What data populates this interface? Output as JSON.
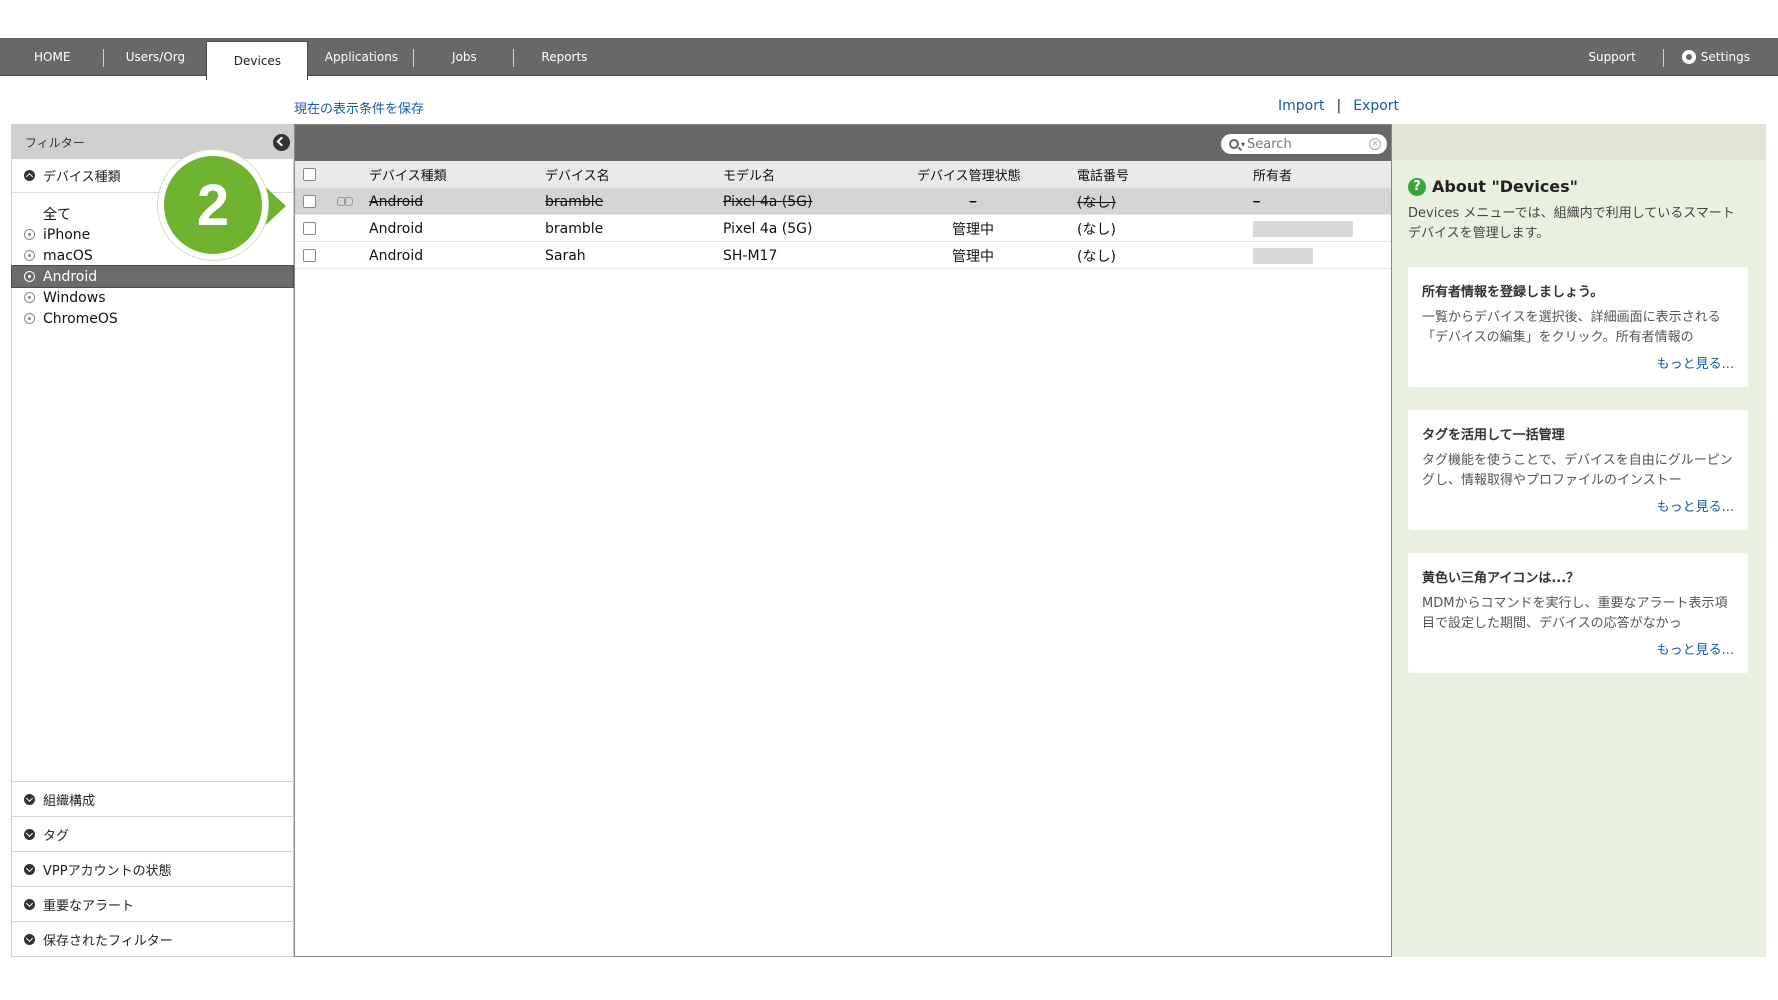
{
  "nav": {
    "tabs": [
      "HOME",
      "Users/Org",
      "Devices",
      "Applications",
      "Jobs",
      "Reports"
    ],
    "active_tab": "Devices",
    "support_label": "Support",
    "settings_label": "Settings"
  },
  "toolbar": {
    "save_view_link": "現在の表示条件を保存",
    "import_label": "Import",
    "export_label": "Export",
    "separator": "|"
  },
  "sidebar": {
    "title": "フィルター",
    "device_type_section": "デバイス種類",
    "options": [
      "全て",
      "iPhone",
      "macOS",
      "Android",
      "Windows",
      "ChromeOS"
    ],
    "selected_option": "Android",
    "bottom_sections": [
      "組織構成",
      "タグ",
      "VPPアカウントの状態",
      "重要なアラート",
      "保存されたフィルター"
    ]
  },
  "table": {
    "search_placeholder": "Search",
    "columns": [
      "デバイス種類",
      "デバイス名",
      "モデル名",
      "デバイス管理状態",
      "電話番号",
      "所有者"
    ],
    "rows": [
      {
        "type": "Android",
        "name": "bramble",
        "model": "Pixel 4a (5G)",
        "status": "–",
        "phone": "(なし)",
        "owner": "–",
        "disabled": true
      },
      {
        "type": "Android",
        "name": "bramble",
        "model": "Pixel 4a (5G)",
        "status": "管理中",
        "phone": "(なし)",
        "owner": "",
        "disabled": false
      },
      {
        "type": "Android",
        "name": "Sarah",
        "model": "SH-M17",
        "status": "管理中",
        "phone": "(なし)",
        "owner": "",
        "disabled": false
      }
    ]
  },
  "help": {
    "about_title": "About \"Devices\"",
    "about_desc": "Devices メニューでは、組織内で利用しているスマートデバイスを管理します。",
    "cards": [
      {
        "title": "所有者情報を登録しましょう。",
        "body": "一覧からデバイスを選択後、詳細画面に表示される「デバイスの編集」をクリック。所有者情報の",
        "more": "もっと見る..."
      },
      {
        "title": "タグを活用して一括管理",
        "body": "タグ機能を使うことで、デバイスを自由にグルーピングし、情報取得やプロファイルのインストー",
        "more": "もっと見る..."
      },
      {
        "title": "黄色い三角アイコンは...？",
        "body": "MDMからコマンドを実行し、重要なアラート表示項目で設定した期間、デバイスの応答がなかっ",
        "more": "もっと見る..."
      }
    ]
  },
  "callout": {
    "number": "2",
    "color": "#6fb22f"
  },
  "colors": {
    "nav_bg": "#686868",
    "link": "#1a5aa6",
    "help_bg": "#eaf0df",
    "selected_bg": "#6b6b6b"
  }
}
